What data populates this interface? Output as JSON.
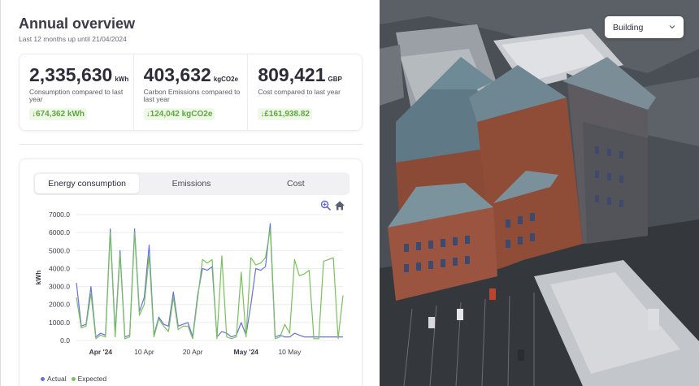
{
  "header": {
    "title": "Annual overview",
    "subtitle": "Last 12 months up until 21/04/2024"
  },
  "stats": [
    {
      "value": "2,335,630",
      "unit": "kWh",
      "label": "Consumption compared to last year",
      "change": "674,362 kWh",
      "change_direction": "down",
      "change_color": "#5fa83e"
    },
    {
      "value": "403,632",
      "unit": "kgCO2e",
      "label": "Carbon Emissions compared to last year",
      "change": "124,042 kgCO2e",
      "change_direction": "down",
      "change_color": "#5fa83e"
    },
    {
      "value": "809,421",
      "unit": "GBP",
      "label": "Cost compared to last year",
      "change": "£161,938.82",
      "change_direction": "down",
      "change_color": "#5fa83e"
    }
  ],
  "chart_tabs": [
    {
      "label": "Energy consumption",
      "active": true
    },
    {
      "label": "Emissions",
      "active": false
    },
    {
      "label": "Cost",
      "active": false
    }
  ],
  "chart_toolbar": {
    "zoom_icon": "zoom-in-icon",
    "reset_icon": "home-icon"
  },
  "view_selector": {
    "selected": "Building",
    "icon": "chevron-down-icon"
  },
  "colors": {
    "actual": "#6670e0",
    "expected": "#78c25a",
    "positive": "#5fa83e"
  },
  "chart_data": {
    "type": "line",
    "title": "",
    "xlabel": "",
    "ylabel": "kWh",
    "ylim": [
      0,
      7000
    ],
    "y_ticks": [
      "7000.0",
      "6000.0",
      "5000.0",
      "4000.0",
      "3000.0",
      "2000.0",
      "1000.0",
      "0.0"
    ],
    "x_ticks": [
      {
        "label": "Apr '24",
        "day": 5,
        "bold": true
      },
      {
        "label": "10 Apr",
        "day": 14,
        "bold": false
      },
      {
        "label": "20 Apr",
        "day": 24,
        "bold": false
      },
      {
        "label": "May '24",
        "day": 35,
        "bold": true
      },
      {
        "label": "10 May",
        "day": 44,
        "bold": false
      }
    ],
    "legend": "bottom-left",
    "grid": true,
    "x_start": "2024-03-27",
    "x_end": "2024-05-21",
    "series": [
      {
        "name": "Actual",
        "color": "#6670e0",
        "values": [
          3200,
          800,
          900,
          3000,
          200,
          400,
          300,
          6200,
          400,
          5000,
          200,
          300,
          6200,
          1600,
          2400,
          5300,
          300,
          1300,
          900,
          800,
          2700,
          800,
          900,
          1000,
          200,
          2500,
          4000,
          3900,
          4100,
          200,
          500,
          400,
          200,
          300,
          1000,
          300,
          2000,
          4000,
          3900,
          4100,
          6500,
          200,
          300,
          200,
          200,
          400,
          300,
          200,
          200,
          200,
          200,
          200,
          200,
          200,
          200,
          200
        ]
      },
      {
        "name": "Expected",
        "color": "#78c25a",
        "values": [
          2400,
          700,
          800,
          2600,
          100,
          300,
          200,
          6000,
          200,
          4800,
          100,
          200,
          6000,
          1400,
          2000,
          4700,
          200,
          1200,
          800,
          500,
          2400,
          600,
          800,
          800,
          100,
          2300,
          4500,
          4300,
          4500,
          100,
          4700,
          200,
          100,
          200,
          3800,
          200,
          4600,
          4200,
          4300,
          4600,
          6200,
          100,
          200,
          900,
          400,
          4500,
          3600,
          3700,
          3900,
          100,
          100,
          4400,
          4500,
          4600,
          100,
          2500
        ]
      }
    ]
  }
}
